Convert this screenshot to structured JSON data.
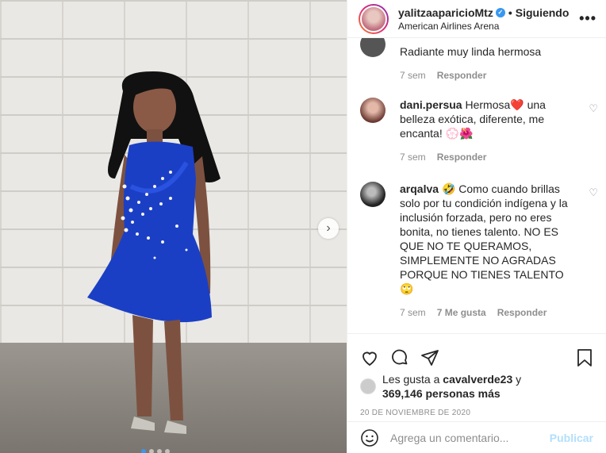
{
  "header": {
    "username": "yalitzaaparicioMtz",
    "separator": "•",
    "following_label": "Siguiendo",
    "location": "American Airlines Arena",
    "more_icon": "ellipsis-icon"
  },
  "comments": [
    {
      "username": "",
      "text": "Radiante muy linda hermosa",
      "time": "7 sem",
      "likes": "",
      "reply": "Responder"
    },
    {
      "username": "dani.persua",
      "text": "Hermosa❤️ una belleza exótica, diferente, me encanta! 💮🌺",
      "time": "7 sem",
      "likes": "",
      "reply": "Responder"
    },
    {
      "username": "arqalva",
      "text": "🤣 Como cuando brillas solo por tu condición indígena y la inclusión forzada, pero no eres bonita, no tienes talento. NO ES QUE NO TE QUERAMOS, SIMPLEMENTE NO AGRADAS PORQUE NO TIENES TALENTO 🙄",
      "time": "7 sem",
      "likes": "7 Me gusta",
      "reply": "Responder"
    }
  ],
  "likes": {
    "prefix": "Les gusta a",
    "user": "cavalverde23",
    "conj": "y",
    "count": "369,146 personas más"
  },
  "date": "20 DE NOVIEMBRE DE 2020",
  "add_comment": {
    "placeholder": "Agrega un comentario...",
    "publish": "Publicar"
  },
  "colors": {
    "accent": "#3897f0",
    "publish_disabled": "#b2dffc",
    "heart_red": "#ed4956"
  }
}
